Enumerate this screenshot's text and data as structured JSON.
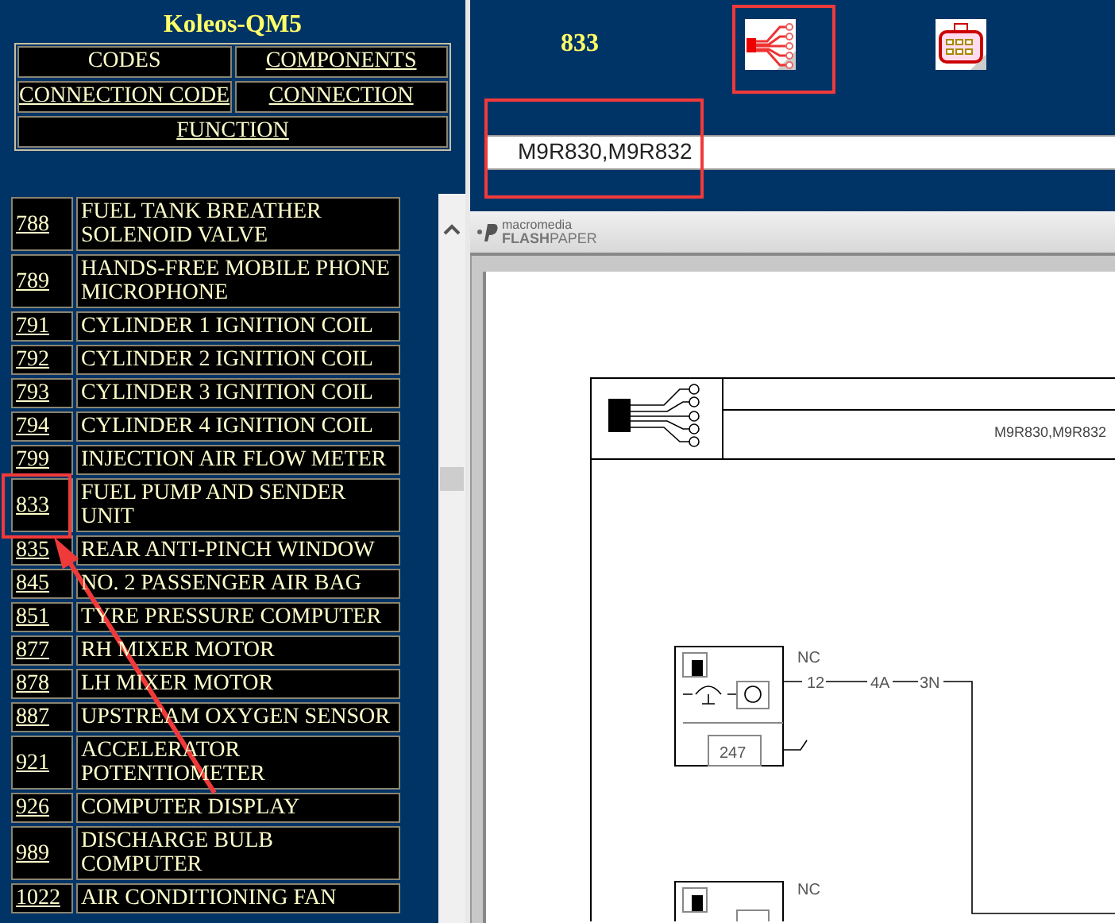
{
  "sidebar": {
    "title": "Koleos-QM5",
    "nav": [
      {
        "label": "CODES",
        "kind": "text"
      },
      {
        "label": "COMPONENTS",
        "kind": "link"
      },
      {
        "label": "CONNECTION CODE",
        "kind": "link"
      },
      {
        "label": "CONNECTION",
        "kind": "link"
      },
      {
        "label": "FUNCTION",
        "kind": "link"
      }
    ],
    "components": [
      {
        "code": "788",
        "name": "FUEL TANK BREATHER SOLENOID VALVE"
      },
      {
        "code": "789",
        "name": "HANDS-FREE MOBILE PHONE MICROPHONE"
      },
      {
        "code": "791",
        "name": "CYLINDER 1 IGNITION COIL"
      },
      {
        "code": "792",
        "name": "CYLINDER 2 IGNITION COIL"
      },
      {
        "code": "793",
        "name": "CYLINDER 3 IGNITION COIL"
      },
      {
        "code": "794",
        "name": "CYLINDER 4 IGNITION COIL"
      },
      {
        "code": "799",
        "name": "INJECTION AIR FLOW METER"
      },
      {
        "code": "833",
        "name": "FUEL PUMP AND SENDER UNIT"
      },
      {
        "code": "835",
        "name": "REAR ANTI-PINCH WINDOW"
      },
      {
        "code": "845",
        "name": "NO. 2 PASSENGER AIR BAG"
      },
      {
        "code": "851",
        "name": "TYRE PRESSURE COMPUTER"
      },
      {
        "code": "877",
        "name": "RH MIXER MOTOR"
      },
      {
        "code": "878",
        "name": "LH MIXER MOTOR"
      },
      {
        "code": "887",
        "name": "UPSTREAM OXYGEN SENSOR"
      },
      {
        "code": "921",
        "name": "ACCELERATOR POTENTIOMETER"
      },
      {
        "code": "926",
        "name": "COMPUTER DISPLAY"
      },
      {
        "code": "989",
        "name": "DISCHARGE BULB COMPUTER"
      },
      {
        "code": "1022",
        "name": "AIR CONDITIONING FAN"
      }
    ]
  },
  "detail": {
    "code": "833",
    "connectors": "M9R830,M9R832"
  },
  "viewer": {
    "brand_small": "macromedia",
    "brand": "**FLASH**PAPER",
    "diagram": {
      "connectors": "M9R830,M9R832",
      "labels": [
        "NC",
        "12",
        "4A",
        "3N",
        "247",
        "NC"
      ]
    }
  }
}
